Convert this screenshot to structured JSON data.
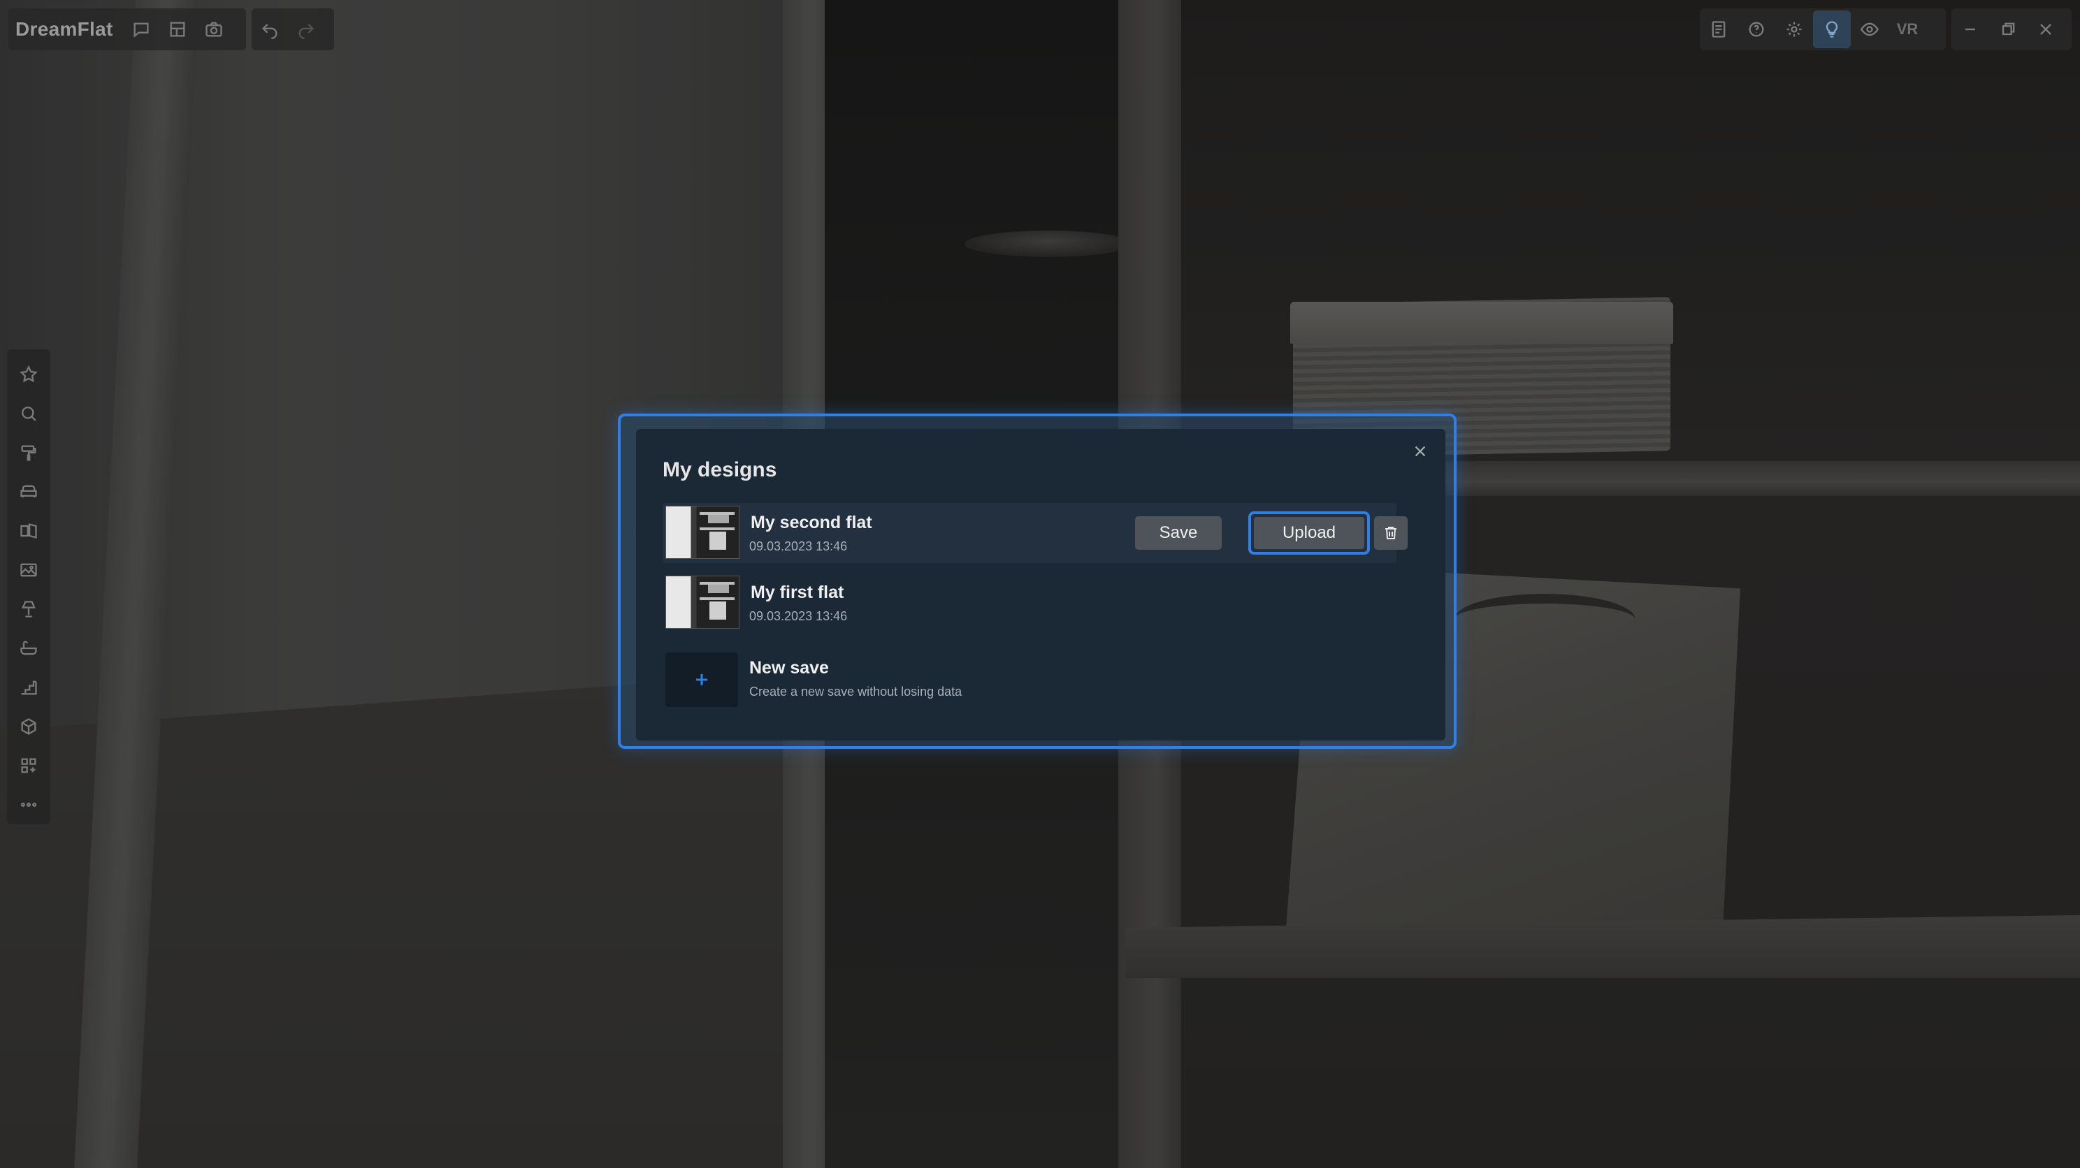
{
  "app": {
    "title": "DreamFlat"
  },
  "toolbar_left": {
    "icons": [
      "chat-icon",
      "layout-icon",
      "camera-icon",
      "undo-icon",
      "redo-icon"
    ]
  },
  "toolbar_right": {
    "icons": [
      "document-icon",
      "help-icon",
      "settings-icon",
      "lightbulb-icon",
      "eye-icon"
    ],
    "vr_label": "VR",
    "window_controls": [
      "minimize-icon",
      "restore-icon",
      "close-icon"
    ],
    "active_icon": "lightbulb-icon"
  },
  "tool_rail": {
    "icons": [
      "star-icon",
      "search-icon",
      "paint-roller-icon",
      "sofa-icon",
      "door-window-icon",
      "picture-icon",
      "lamp-icon",
      "bathtub-icon",
      "stairs-icon",
      "cube-icon",
      "apps-add-icon",
      "more-icon"
    ]
  },
  "dialog": {
    "title": "My designs",
    "saves": [
      {
        "name": "My second flat",
        "date": "09.03.2023 13:46",
        "selected": true,
        "save_label": "Save",
        "upload_label": "Upload"
      },
      {
        "name": "My first flat",
        "date": "09.03.2023 13:46",
        "selected": false
      }
    ],
    "new_save": {
      "title": "New save",
      "subtitle": "Create a new save without losing data"
    }
  },
  "colors": {
    "accent": "#2f7fe6",
    "dialog_bg": "#1b2835",
    "button_bg": "#4e545a"
  }
}
